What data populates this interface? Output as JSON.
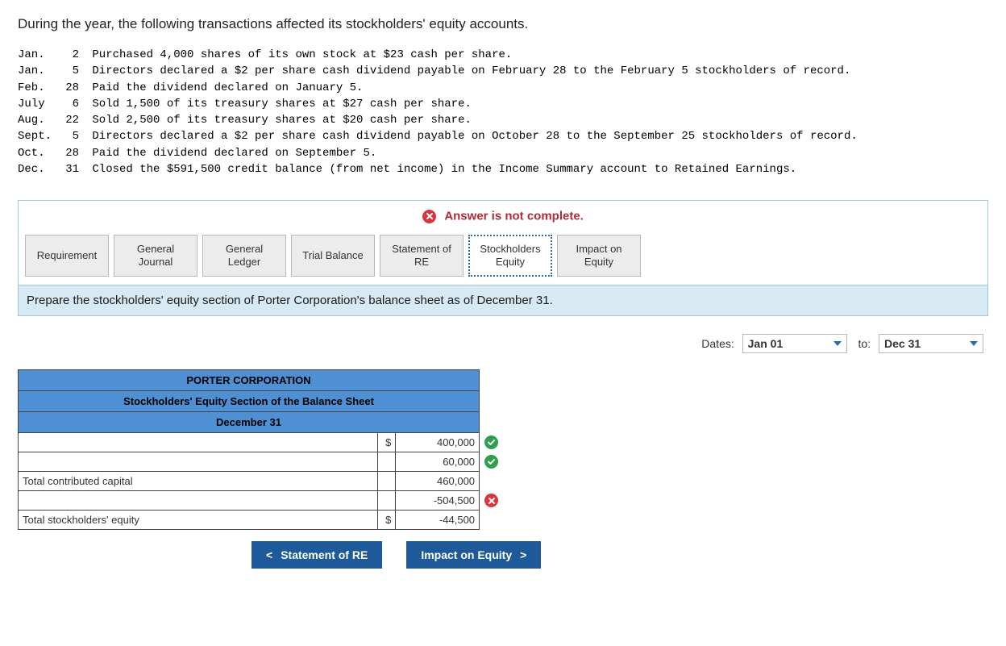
{
  "intro": "During the year, the following transactions affected its stockholders' equity accounts.",
  "transactions": [
    {
      "month": "Jan.",
      "day": "2",
      "desc": "Purchased 4,000 shares of its own stock at $23 cash per share."
    },
    {
      "month": "Jan.",
      "day": "5",
      "desc": "Directors declared a $2 per share cash dividend payable on February 28 to the February 5 stockholders of record."
    },
    {
      "month": "Feb.",
      "day": "28",
      "desc": "Paid the dividend declared on January 5."
    },
    {
      "month": "July",
      "day": "6",
      "desc": "Sold 1,500 of its treasury shares at $27 cash per share."
    },
    {
      "month": "Aug.",
      "day": "22",
      "desc": "Sold 2,500 of its treasury shares at $20 cash per share."
    },
    {
      "month": "Sept.",
      "day": "5",
      "desc": "Directors declared a $2 per share cash dividend payable on October 28 to the September 25 stockholders of record."
    },
    {
      "month": "Oct.",
      "day": "28",
      "desc": "Paid the dividend declared on September 5."
    },
    {
      "month": "Dec.",
      "day": "31",
      "desc": "Closed the $591,500 credit balance (from net income) in the Income Summary account to Retained Earnings."
    }
  ],
  "banner": "Answer is not complete.",
  "tabs": {
    "requirement": "Requirement",
    "general_journal": "General\nJournal",
    "general_ledger": "General\nLedger",
    "trial_balance": "Trial Balance",
    "statement_re": "Statement of\nRE",
    "stockholders_equity": "Stockholders\nEquity",
    "impact_equity": "Impact on\nEquity"
  },
  "instruction": "Prepare the stockholders' equity section of Porter Corporation's balance sheet as of December 31.",
  "dates": {
    "label": "Dates:",
    "from": "Jan 01",
    "to_label": "to:",
    "to": "Dec 31"
  },
  "sheet": {
    "company": "PORTER CORPORATION",
    "title": "Stockholders' Equity Section of the Balance Sheet",
    "asof": "December 31",
    "rows": [
      {
        "desc": "",
        "cur": "$",
        "amt": "400,000",
        "mark": "ok"
      },
      {
        "desc": "",
        "cur": "",
        "amt": "60,000",
        "mark": "ok"
      },
      {
        "desc": "Total contributed capital",
        "cur": "",
        "amt": "460,000",
        "mark": ""
      },
      {
        "desc": "",
        "cur": "",
        "amt": "-504,500",
        "mark": "bad"
      },
      {
        "desc": "Total stockholders' equity",
        "cur": "$",
        "amt": "-44,500",
        "mark": ""
      }
    ]
  },
  "nav": {
    "prev": "Statement of RE",
    "next": "Impact on Equity"
  }
}
